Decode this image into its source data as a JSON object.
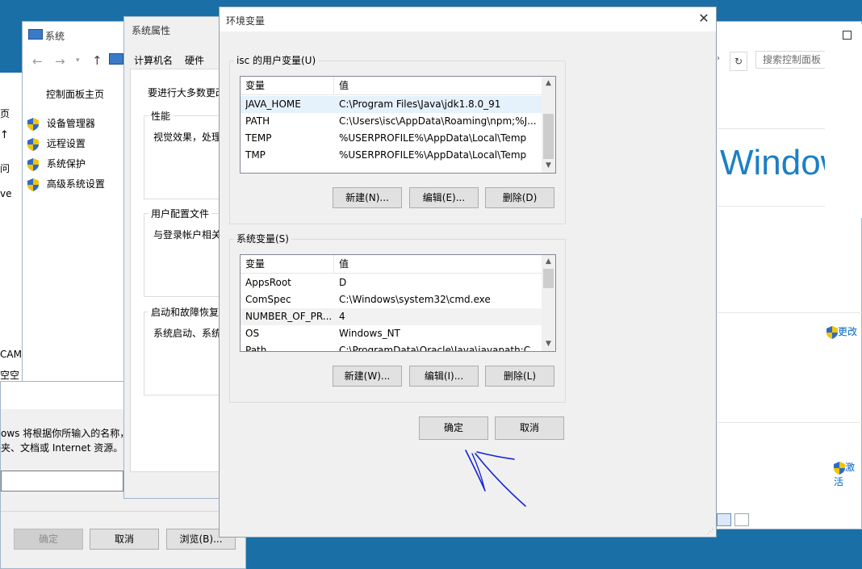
{
  "cpanel": {
    "title": "系统",
    "home": "控制面板主页",
    "links": [
      "设备管理器",
      "远程设置",
      "系统保护",
      "高级系统设置"
    ],
    "search_placeholder": "搜索控制面板",
    "windows_logo_text": "Windows",
    "change_label": "更改",
    "activate_label": "激活"
  },
  "left_fragments": {
    "line1": "页",
    "line2": "问",
    "line3": "ve",
    "line4": "CAM",
    "line5": "空空"
  },
  "run_dialog": {
    "desc1": "ows 将根据你所输入的名称，",
    "desc2": "夹、文档或 Internet 资源。",
    "ok": "确定",
    "cancel": "取消",
    "browse": "浏览(B)..."
  },
  "sysprops": {
    "title": "系统属性",
    "tabs": [
      "计算机名",
      "硬件"
    ],
    "intro": "要进行大多数更改",
    "perf_label": "性能",
    "perf_text": "视觉效果，处理",
    "profile_label": "用户配置文件",
    "profile_text": "与登录帐户相关",
    "startup_label": "启动和故障恢复",
    "startup_text": "系统启动、系统"
  },
  "env": {
    "title": "环境变量",
    "user_group_label": "isc 的用户变量(U)",
    "col_var": "变量",
    "col_val": "值",
    "user_vars": [
      {
        "name": "JAVA_HOME",
        "value": "C:\\Program Files\\Java\\jdk1.8.0_91"
      },
      {
        "name": "PATH",
        "value": "C:\\Users\\isc\\AppData\\Roaming\\npm;%J..."
      },
      {
        "name": "TEMP",
        "value": "%USERPROFILE%\\AppData\\Local\\Temp"
      },
      {
        "name": "TMP",
        "value": "%USERPROFILE%\\AppData\\Local\\Temp"
      }
    ],
    "user_new": "新建(N)...",
    "user_edit": "编辑(E)...",
    "user_delete": "删除(D)",
    "sys_group_label": "系统变量(S)",
    "sys_vars": [
      {
        "name": "AppsRoot",
        "value": "D"
      },
      {
        "name": "ComSpec",
        "value": "C:\\Windows\\system32\\cmd.exe"
      },
      {
        "name": "NUMBER_OF_PR...",
        "value": "4"
      },
      {
        "name": "OS",
        "value": "Windows_NT"
      },
      {
        "name": "Path",
        "value": "C:\\ProgramData\\Oracle\\Java\\javapath;C..."
      }
    ],
    "sys_new": "新建(W)...",
    "sys_edit": "编辑(I)...",
    "sys_delete": "删除(L)",
    "ok": "确定",
    "cancel": "取消"
  }
}
